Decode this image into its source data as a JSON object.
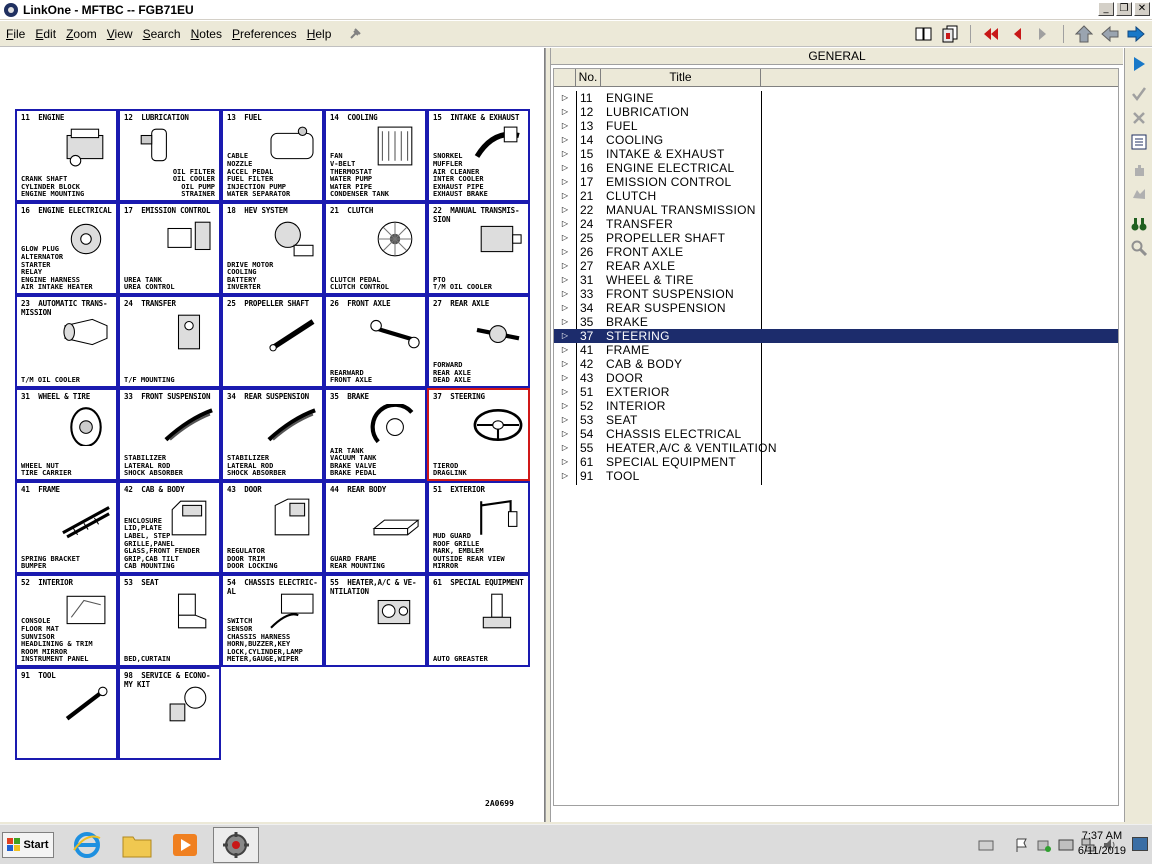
{
  "window": {
    "title": "LinkOne - MFTBC -- FGB71EU"
  },
  "menu": [
    {
      "label": "File",
      "acc": "F",
      "rest": "ile"
    },
    {
      "label": "Edit",
      "acc": "E",
      "rest": "dit"
    },
    {
      "label": "Zoom",
      "acc": "Z",
      "rest": "oom"
    },
    {
      "label": "View",
      "acc": "V",
      "rest": "iew"
    },
    {
      "label": "Search",
      "acc": "S",
      "rest": "earch"
    },
    {
      "label": "Notes",
      "acc": "N",
      "rest": "otes"
    },
    {
      "label": "Preferences",
      "acc": "P",
      "rest": "references"
    },
    {
      "label": "Help",
      "acc": "H",
      "rest": "elp"
    }
  ],
  "drawing": {
    "code": "2A0699",
    "cells": [
      {
        "title": "11  ENGINE",
        "parts": "CRANK SHAFT\nCYLINDER BLOCK\nENGINE MOUNTING",
        "icon": "engine"
      },
      {
        "title": "12  LUBRICATION",
        "parts": "OIL FILTER\nOIL COOLER\nOIL PUMP\nSTRAINER",
        "align": "right",
        "icon": "oil-filter"
      },
      {
        "title": "13  FUEL",
        "parts": "CABLE\nNOZZLE\nACCEL PEDAL\nFUEL FILTER\nINJECTION PUMP\nWATER SEPARATOR",
        "icon": "fuel-tank"
      },
      {
        "title": "14  COOLING",
        "parts": "FAN\nV-BELT\nTHERMOSTAT\nWATER PUMP\nWATER PIPE\nCONDENSER TANK",
        "icon": "radiator"
      },
      {
        "title": "15  INTAKE & EXHAUST",
        "parts": "SNORKEL\nMUFFLER\nAIR CLEANER\nINTER COOLER\nEXHAUST PIPE\nEXHAUST BRAKE",
        "icon": "exhaust"
      },
      {
        "title": "16  ENGINE ELECTRICAL",
        "parts": "GLOW PLUG\nALTERNATOR\nSTARTER\nRELAY\nENGINE HARNESS\nAIR INTAKE HEATER",
        "icon": "alternator"
      },
      {
        "title": "17  EMISSION CONTROL",
        "parts": "UREA TANK\nUREA CONTROL",
        "icon": "urea-tank"
      },
      {
        "title": "18  HEV SYSTEM",
        "parts": "DRIVE MOTOR\nCOOLING\nBATTERY\nINVERTER",
        "icon": "motor"
      },
      {
        "title": "21  CLUTCH",
        "parts": "CLUTCH PEDAL\nCLUTCH CONTROL",
        "icon": "clutch"
      },
      {
        "title": "22  MANUAL TRANSMIS-\nSION",
        "parts": "PTO\nT/M OIL COOLER",
        "icon": "transmission"
      },
      {
        "title": "23  AUTOMATIC TRANS-\nMISSION",
        "parts": "T/M OIL COOLER",
        "icon": "auto-trans"
      },
      {
        "title": "24  TRANSFER",
        "parts": "T/F MOUNTING",
        "icon": "transfer"
      },
      {
        "title": "25  PROPELLER SHAFT",
        "parts": "",
        "icon": "shaft"
      },
      {
        "title": "26  FRONT AXLE",
        "parts": "REARWARD\nFRONT AXLE",
        "icon": "front-axle"
      },
      {
        "title": "27  REAR AXLE",
        "parts": "FORWARD\nREAR AXLE\nDEAD AXLE",
        "icon": "rear-axle"
      },
      {
        "title": "31  WHEEL & TIRE",
        "parts": "WHEEL NUT\nTIRE CARRIER",
        "icon": "tire"
      },
      {
        "title": "33  FRONT SUSPENSION",
        "parts": "STABILIZER\nLATERAL ROD\nSHOCK ABSORBER",
        "icon": "leaf-spring"
      },
      {
        "title": "34  REAR SUSPENSION",
        "parts": "STABILIZER\nLATERAL ROD\nSHOCK ABSORBER",
        "icon": "leaf-spring-rear"
      },
      {
        "title": "35  BRAKE",
        "parts": "AIR TANK\nVACUUM TANK\nBRAKE VALVE\nBRAKE PEDAL",
        "icon": "brake"
      },
      {
        "title": "37  STEERING",
        "parts": "TIEROD\nDRAGLINK",
        "icon": "steering-wheel",
        "selected": true
      },
      {
        "title": "41  FRAME",
        "parts": "SPRING BRACKET\nBUMPER",
        "icon": "frame"
      },
      {
        "title": "42  CAB & BODY",
        "parts": "ENCLOSURE\nLID,PLATE\nLABEL, STEP\nGRILLE,PANEL\nGLASS,FRONT FENDER\nGRIP,CAB TILT\nCAB MOUNTING",
        "icon": "cab"
      },
      {
        "title": "43  DOOR",
        "parts": "REGULATOR\nDOOR TRIM\nDOOR LOCKING",
        "icon": "door"
      },
      {
        "title": "44  REAR BODY",
        "parts": "GUARD FRAME\nREAR MOUNTING",
        "icon": "rear-body"
      },
      {
        "title": "51  EXTERIOR",
        "parts": "MUD GUARD\nROOF GRILLE\nMARK, EMBLEM\nOUTSIDE REAR VIEW\nMIRROR",
        "icon": "mirror"
      },
      {
        "title": "52  INTERIOR",
        "parts": "CONSOLE\nFLOOR MAT\nSUNVISOR\nHEADLINING & TRIM\nROOM MIRROR\nINSTRUMENT PANEL",
        "icon": "interior"
      },
      {
        "title": "53  SEAT",
        "parts": "BED,CURTAIN",
        "icon": "seat"
      },
      {
        "title": "54  CHASSIS ELECTRIC-\nAL",
        "parts": "SWITCH\nSENSOR\nCHASSIS HARNESS\nHORN,BUZZER,KEY\nLOCK,CYLINDER,LAMP\nMETER,GAUGE,WIPER",
        "icon": "harness"
      },
      {
        "title": "55  HEATER,A/C & VE-\nNTILATION",
        "parts": "",
        "icon": "heater"
      },
      {
        "title": "61  SPECIAL EQUIPMENT",
        "parts": "AUTO GREASTER",
        "icon": "greaser"
      },
      {
        "title": "91  TOOL",
        "parts": "",
        "icon": "tool"
      },
      {
        "title": "98  SERVICE & ECONO-\nMY KIT",
        "parts": "",
        "icon": "service-kit"
      }
    ]
  },
  "list_pane": {
    "header": "GENERAL",
    "col_no": "No.",
    "col_title": "Title",
    "rows": [
      {
        "no": "11",
        "title": "ENGINE"
      },
      {
        "no": "12",
        "title": "LUBRICATION"
      },
      {
        "no": "13",
        "title": "FUEL"
      },
      {
        "no": "14",
        "title": "COOLING"
      },
      {
        "no": "15",
        "title": "INTAKE & EXHAUST"
      },
      {
        "no": "16",
        "title": "ENGINE ELECTRICAL"
      },
      {
        "no": "17",
        "title": "EMISSION CONTROL"
      },
      {
        "no": "21",
        "title": "CLUTCH"
      },
      {
        "no": "22",
        "title": "MANUAL TRANSMISSION"
      },
      {
        "no": "24",
        "title": "TRANSFER"
      },
      {
        "no": "25",
        "title": "PROPELLER SHAFT"
      },
      {
        "no": "26",
        "title": "FRONT AXLE"
      },
      {
        "no": "27",
        "title": "REAR AXLE"
      },
      {
        "no": "31",
        "title": "WHEEL & TIRE"
      },
      {
        "no": "33",
        "title": "FRONT SUSPENSION"
      },
      {
        "no": "34",
        "title": "REAR SUSPENSION"
      },
      {
        "no": "35",
        "title": "BRAKE"
      },
      {
        "no": "37",
        "title": "STEERING",
        "selected": true
      },
      {
        "no": "41",
        "title": "FRAME"
      },
      {
        "no": "42",
        "title": "CAB & BODY"
      },
      {
        "no": "43",
        "title": "DOOR"
      },
      {
        "no": "51",
        "title": "EXTERIOR"
      },
      {
        "no": "52",
        "title": "INTERIOR"
      },
      {
        "no": "53",
        "title": "SEAT"
      },
      {
        "no": "54",
        "title": "CHASSIS ELECTRICAL"
      },
      {
        "no": "55",
        "title": "HEATER,A/C & VENTILATION"
      },
      {
        "no": "61",
        "title": "SPECIAL EQUIPMENT"
      },
      {
        "no": "91",
        "title": "TOOL"
      }
    ]
  },
  "taskbar": {
    "start_label": "Start",
    "time": "7:37 AM",
    "date": "6/11/2019"
  },
  "colors": {
    "cell_border": "#1a1ab0",
    "selected_cell_border": "#d01818",
    "selected_row_bg": "#1c2c6c",
    "nav_arrow_red": "#c81818",
    "nav_arrow_blue": "#1878c8"
  }
}
